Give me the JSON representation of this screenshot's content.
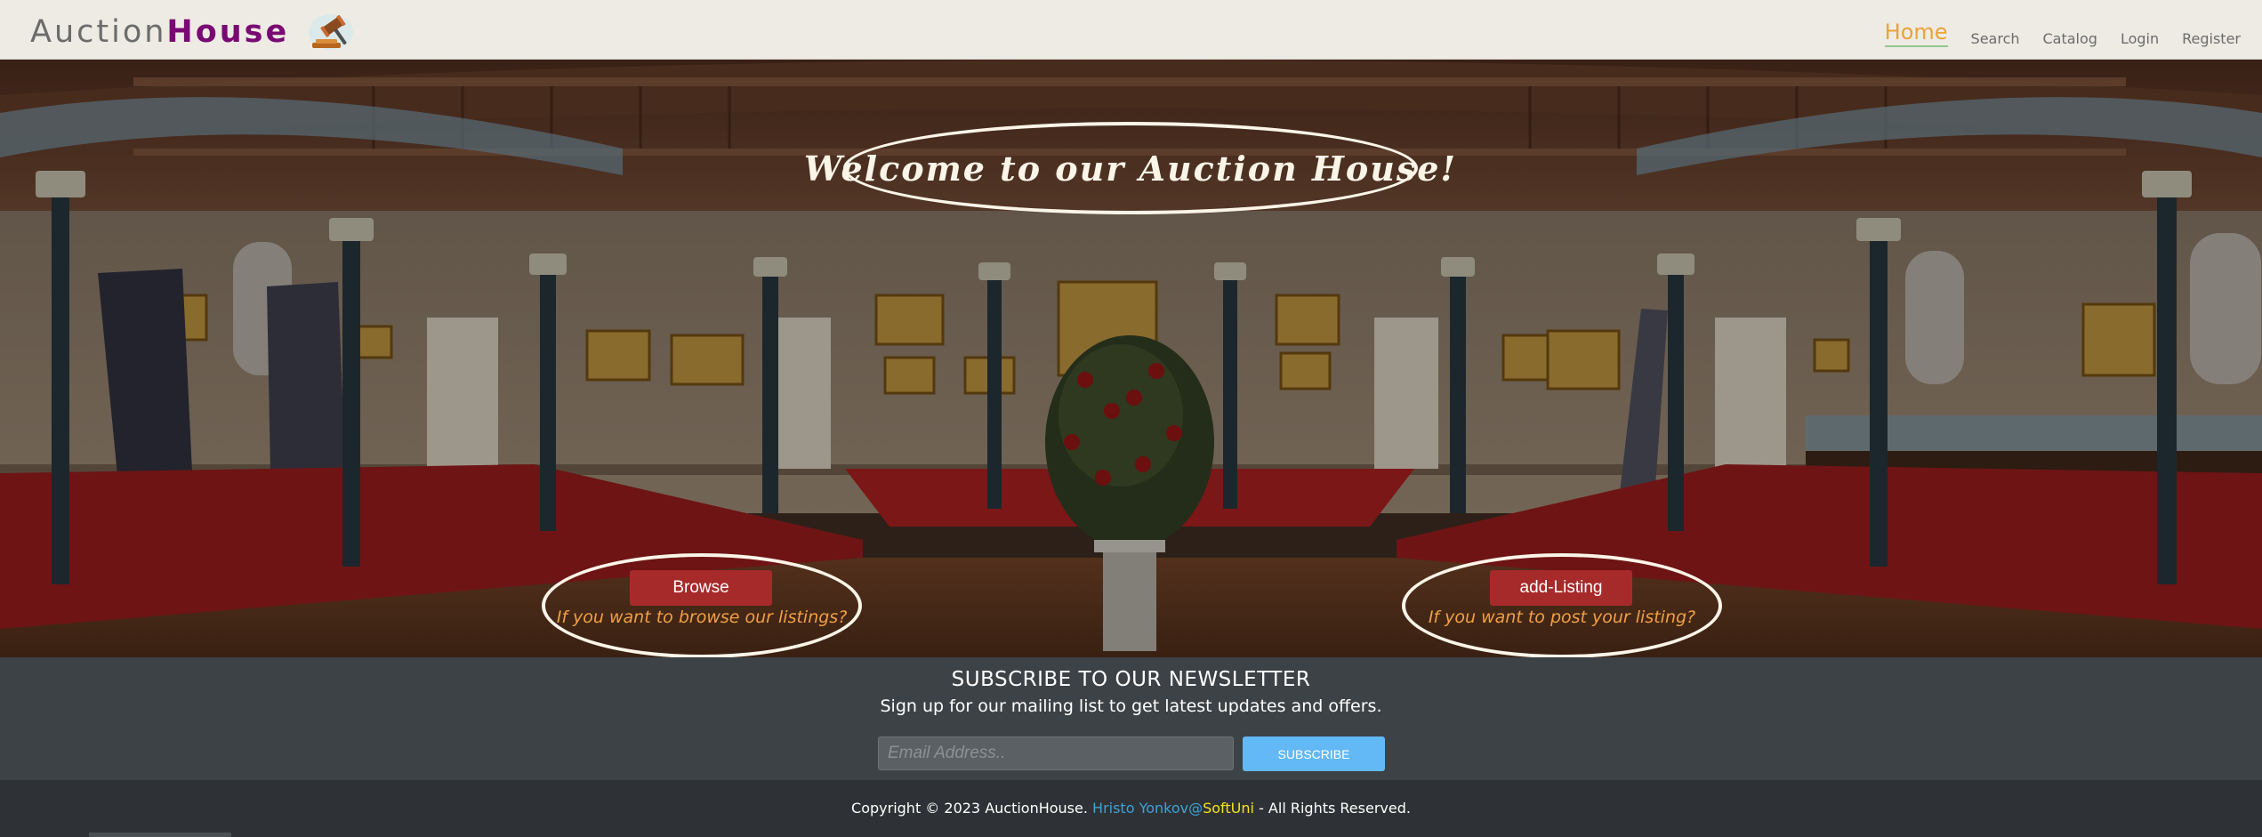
{
  "header": {
    "logo_light": "Auction",
    "logo_bold": "House",
    "logo_icon": "gavel-icon",
    "nav": {
      "home": "Home",
      "search": "Search",
      "catalog": "Catalog",
      "login": "Login",
      "register": "Register"
    }
  },
  "hero": {
    "welcome": "Welcome to our Auction House!",
    "browse": {
      "button": "Browse",
      "note": "If you want to browse our listings?"
    },
    "add_listing": {
      "button": "add-Listing",
      "note": "If you want to post your listing?"
    }
  },
  "newsletter": {
    "title": "SUBSCRIBE TO OUR NEWSLETTER",
    "subtitle": "Sign up for our mailing list to get latest updates and offers.",
    "email_placeholder": "Email Address..",
    "email_value": "",
    "subscribe": "SUBSCRIBE"
  },
  "footer": {
    "copyright": "Copyright © 2023 AuctionHouse. ",
    "author": "Hristo Yonkov@",
    "org": "SoftUni",
    "rights": " - All Rights Reserved."
  },
  "colors": {
    "brand_purple": "#7a0a73",
    "active_nav": "#e9a339",
    "cta_red": "#a72a2a",
    "cta_note": "#f0a045",
    "subscribe_blue": "#62b9f6",
    "footer_link": "#3da2d6",
    "footer_org": "#f4e21b"
  }
}
